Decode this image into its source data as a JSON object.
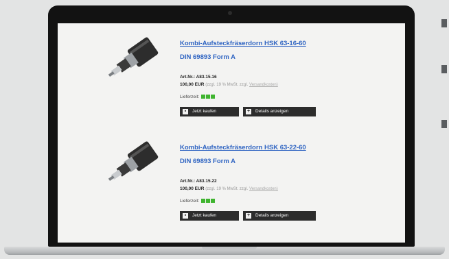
{
  "products": [
    {
      "title_line1": "Kombi-Aufsteckfräserdorn HSK 63-16-60",
      "title_line2": "DIN 69893 Form A",
      "art_nr": "Art.Nr.: A83.15.16",
      "price": "100,00 EUR",
      "vat_note": "(zzgl. 19 % MwSt. zzgl.",
      "shipping_link": "Versandkosten)",
      "delivery_label": "Lieferzeit:",
      "delivery_status": "green",
      "buy_button": "Jetzt kaufen",
      "details_button": "Details anzeigen"
    },
    {
      "title_line1": "Kombi-Aufsteckfräserdorn HSK 63-22-60",
      "title_line2": "DIN 69893 Form A",
      "art_nr": "Art.Nr.: A83.15.22",
      "price": "100,00 EUR",
      "vat_note": "(zzgl. 19 % MwSt. zzgl.",
      "shipping_link": "Versandkosten)",
      "delivery_label": "Lieferzeit:",
      "delivery_status": "green",
      "buy_button": "Jetzt kaufen",
      "details_button": "Details anzeigen"
    }
  ],
  "icons": {
    "product_image": "milling-arbor-icon",
    "cart": "cart-icon",
    "details": "plus-icon"
  },
  "colors": {
    "link": "#2f64c2",
    "delivery_green": "#3fb42f",
    "button_bg": "#2c2c2c"
  }
}
